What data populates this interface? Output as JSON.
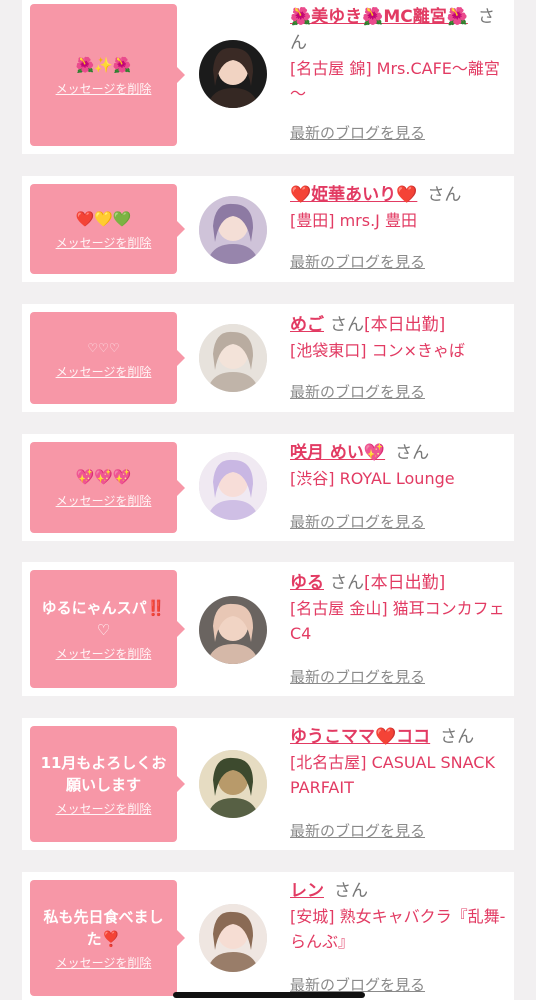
{
  "delete_label": "メッセージを削除",
  "blog_label": "最新のブログを見る",
  "san_label": "さん",
  "colors": {
    "accent": "#e23b63",
    "bubble": "#f797a7",
    "background": "#f2f0f1"
  },
  "cards": [
    {
      "message": "🌺✨🌺",
      "name": "🌺美ゆき🌺MC離宮🌺",
      "status": "",
      "shop": "[名古屋 錦] Mrs.CAFE～離宮～",
      "avatar_icon": "profile-photo-icon"
    },
    {
      "message": "❤️💛💚",
      "name": "❤️姫華あいり❤️",
      "status": "",
      "shop": "[豊田] mrs.J 豊田",
      "avatar_icon": "profile-photo-icon"
    },
    {
      "message": "♡♡♡",
      "name": "めご",
      "status": "[本日出勤]",
      "shop": "[池袋東口] コン×きゃば",
      "avatar_icon": "profile-photo-icon"
    },
    {
      "message": "💖💖💖",
      "name": "咲月 めい💖",
      "status": "",
      "shop": "[渋谷] ROYAL Lounge",
      "avatar_icon": "profile-photo-icon"
    },
    {
      "message": "ゆるにゃんスパ‼️\n♡",
      "name": "ゆる",
      "status": "[本日出勤]",
      "shop": "[名古屋 金山] 猫耳コンカフェ C4",
      "avatar_icon": "profile-photo-icon"
    },
    {
      "message": "11月もよろしくお願いします",
      "name": "ゆうこママ❤️ココ",
      "status": "",
      "shop": "[北名古屋] CASUAL SNACK PARFAIT",
      "avatar_icon": "profile-photo-icon"
    },
    {
      "message": "私も先日食べました❣️",
      "name": "レン",
      "status": "",
      "shop": "[安城] 熟女キャバクラ『乱舞-らんぶ』",
      "avatar_icon": "profile-photo-icon"
    }
  ]
}
